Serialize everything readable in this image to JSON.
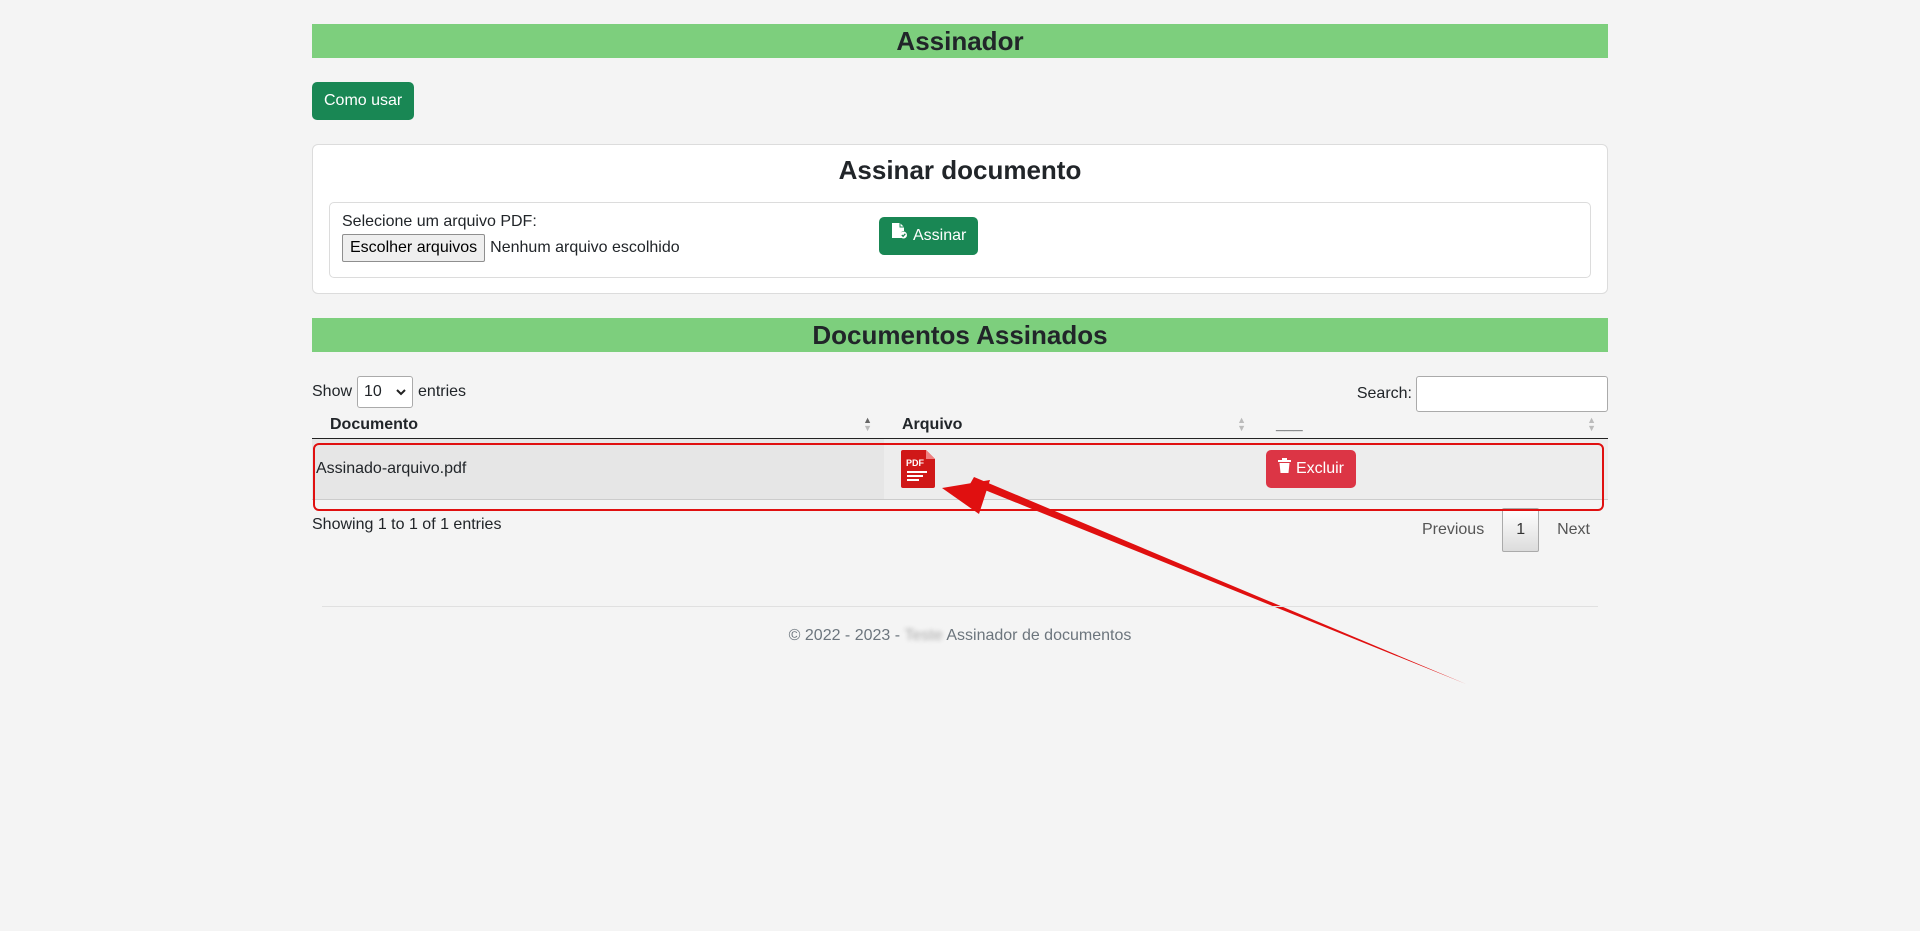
{
  "header": {
    "title": "Assinador"
  },
  "help_button": {
    "label": "Como usar"
  },
  "sign_card": {
    "title": "Assinar documento",
    "file_label": "Selecione um arquivo PDF:",
    "file_button": "Escolher arquivos",
    "file_status": "Nenhum arquivo escolhido",
    "submit_label": "Assinar"
  },
  "documents": {
    "title": "Documentos Assinados",
    "show_label": "Show",
    "entries_value": "10",
    "entries_label": "entries",
    "search_label": "Search:",
    "columns": [
      "Documento",
      "Arquivo",
      "___"
    ],
    "rows": [
      {
        "name": "Assinado-arquivo.pdf",
        "file_icon": "pdf-file-icon",
        "action_label": "Excluir"
      }
    ],
    "pdf_icon_text": "PDF",
    "info": "Showing 1 to 1 of 1 entries",
    "pagination": {
      "previous": "Previous",
      "current": "1",
      "next": "Next"
    }
  },
  "footer": {
    "prefix": "© 2022 - 2023 -",
    "blurred": "Teste",
    "suffix": "Assinador de documentos"
  },
  "colors": {
    "banner": "#7dcf7d",
    "primary": "#198754",
    "danger": "#dc3545",
    "annotation": "#e01010"
  }
}
